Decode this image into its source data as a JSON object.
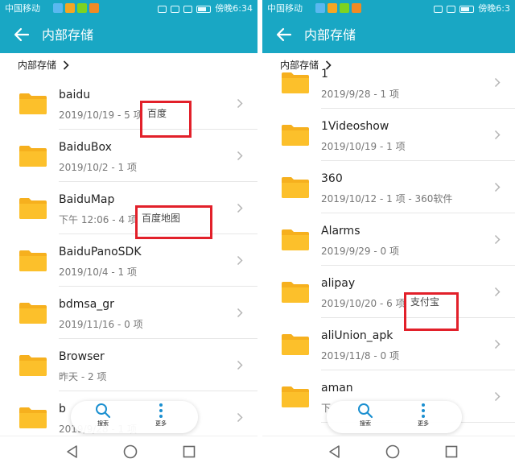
{
  "colors": {
    "accent": "#19a7c4",
    "folder": "#fcc02b",
    "annotation": "#e2202a"
  },
  "phones": [
    {
      "status": {
        "carrier": "中国移动",
        "time": "傍晚6:34"
      },
      "appbar": {
        "title": "内部存储",
        "back_icon": "arrow-left-icon"
      },
      "breadcrumb": {
        "label": "内部存储",
        "icon": "chevron-right-icon"
      },
      "folders": [
        {
          "name": "baidu",
          "meta": "2019/10/19 - 5 项"
        },
        {
          "name": "BaiduBox",
          "meta": "2019/10/2 - 1 项"
        },
        {
          "name": "BaiduMap",
          "meta": "下午 12:06 - 4 项"
        },
        {
          "name": "BaiduPanoSDK",
          "meta": "2019/10/4 - 1 项"
        },
        {
          "name": "bdmsa_gr",
          "meta": "2019/11/16 - 0 项"
        },
        {
          "name": "Browser",
          "meta": "昨天 - 2 项"
        },
        {
          "name": "b",
          "meta": "2019/9/28 - 1 项"
        }
      ],
      "annotations": [
        "百度",
        "百度地图"
      ],
      "fab": {
        "search_label": "搜索",
        "more_label": "更多"
      }
    },
    {
      "status": {
        "carrier": "中国移动",
        "time": "傍晚6:3"
      },
      "appbar": {
        "title": "内部存储",
        "back_icon": "arrow-left-icon"
      },
      "breadcrumb": {
        "label": "内部存储",
        "icon": "chevron-right-icon"
      },
      "folders": [
        {
          "name": "1",
          "meta": "2019/9/28 - 1 项"
        },
        {
          "name": "1Videoshow",
          "meta": "2019/10/19 - 1 项"
        },
        {
          "name": "360",
          "meta": "2019/10/12 - 1 项 - 360软件"
        },
        {
          "name": "Alarms",
          "meta": "2019/9/29 - 0 项"
        },
        {
          "name": "alipay",
          "meta": "2019/10/20 - 6 项"
        },
        {
          "name": "aliUnion_apk",
          "meta": "2019/11/8 - 0 项"
        },
        {
          "name": "aman",
          "meta": "下"
        }
      ],
      "annotations": [
        "支付宝"
      ],
      "fab": {
        "search_label": "搜索",
        "more_label": "更多"
      }
    }
  ],
  "navbar": {
    "back_icon": "triangle-back-icon",
    "home_icon": "circle-home-icon",
    "recents_icon": "square-recents-icon"
  }
}
